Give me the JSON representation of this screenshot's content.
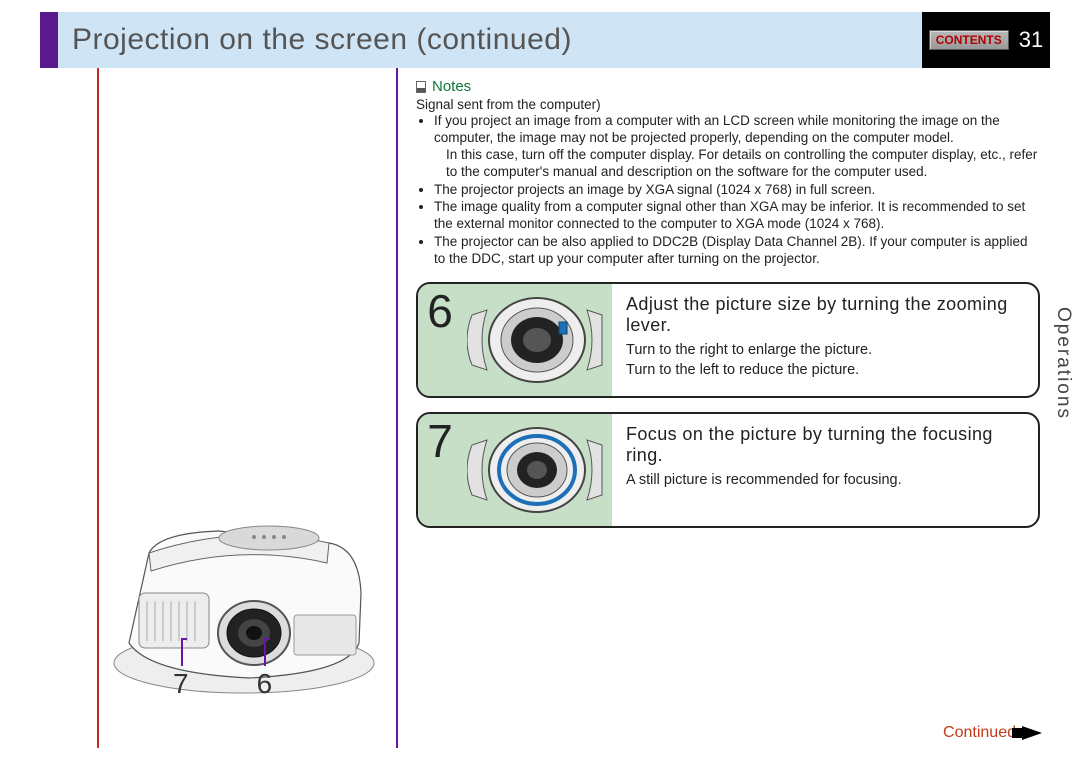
{
  "header": {
    "title": "Projection on the screen (continued)",
    "contents_label": "CONTENTS",
    "page_number": "31"
  },
  "section_tab": "Operations",
  "notes": {
    "heading": "Notes",
    "subheading": "Signal sent from the computer)",
    "items": [
      "If you project an image from a computer with an LCD screen while monitoring the image on the computer, the image may not be projected properly, depending on the computer model.",
      "In this case, turn off the computer display. For details on controlling the computer display, etc., refer to the computer's manual and description on the software for the computer used.",
      "The projector projects an image by XGA signal (1024 x 768) in full screen.",
      "The image quality from a computer signal other than XGA may be inferior. It is recommended to set the external monitor connected to the computer to XGA mode (1024 x 768).",
      "The projector can be also applied to DDC2B (Display Data Channel 2B). If your computer is applied to the DDC, start up your computer after turning on the projector."
    ]
  },
  "steps": [
    {
      "num": "6",
      "title": "Adjust the picture size by turning the zooming lever.",
      "desc": "Turn to the right to enlarge the picture.\nTurn to the left to reduce the picture."
    },
    {
      "num": "7",
      "title": "Focus on the picture by turning the focusing ring.",
      "desc": "A still picture is recommended for focusing."
    }
  ],
  "callouts": {
    "left": "7",
    "right": "6"
  },
  "footer": {
    "continued": "Continued"
  }
}
